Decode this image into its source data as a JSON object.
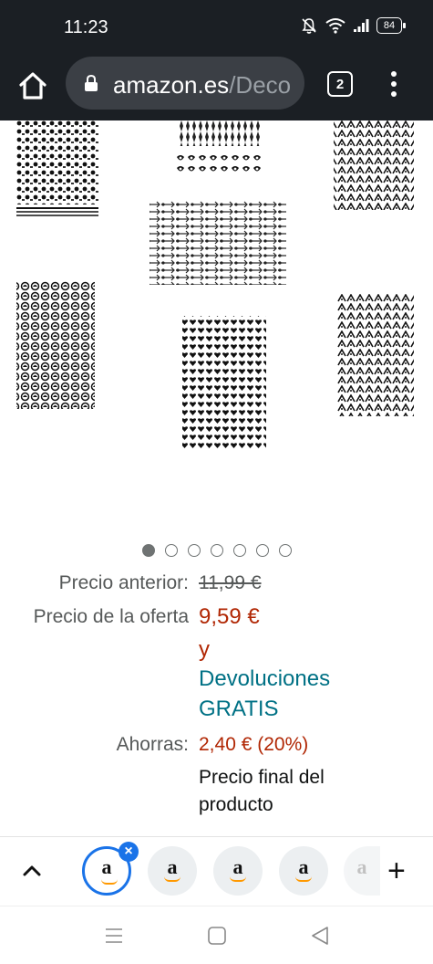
{
  "status_bar": {
    "time": "11:23",
    "battery": "84"
  },
  "browser": {
    "url_domain": "amazon.es",
    "url_path": "/Deco",
    "tab_count": "2"
  },
  "gallery": {
    "image_count": 7,
    "active_index": 0
  },
  "pricing": {
    "old_price_label": "Precio anterior:",
    "old_price": "11,99 €",
    "deal_label": "Precio de la oferta",
    "deal_price": "9,59 €",
    "deal_y": "y",
    "free_returns_1": "Devoluciones",
    "free_returns_2": "GRATIS",
    "savings_label": "Ahorras:",
    "savings": "2,40 € (20%)",
    "final_price_1": "Precio final del",
    "final_price_2": "producto"
  },
  "tab_strip": {
    "tab_logo": "a",
    "close_symbol": "×",
    "new_tab_symbol": "+"
  },
  "colors": {
    "status_bg": "#1b1f24",
    "price_red": "#b12704",
    "link_teal": "#007185",
    "active_tab_blue": "#1a73e8",
    "amazon_orange": "#ff9900"
  }
}
